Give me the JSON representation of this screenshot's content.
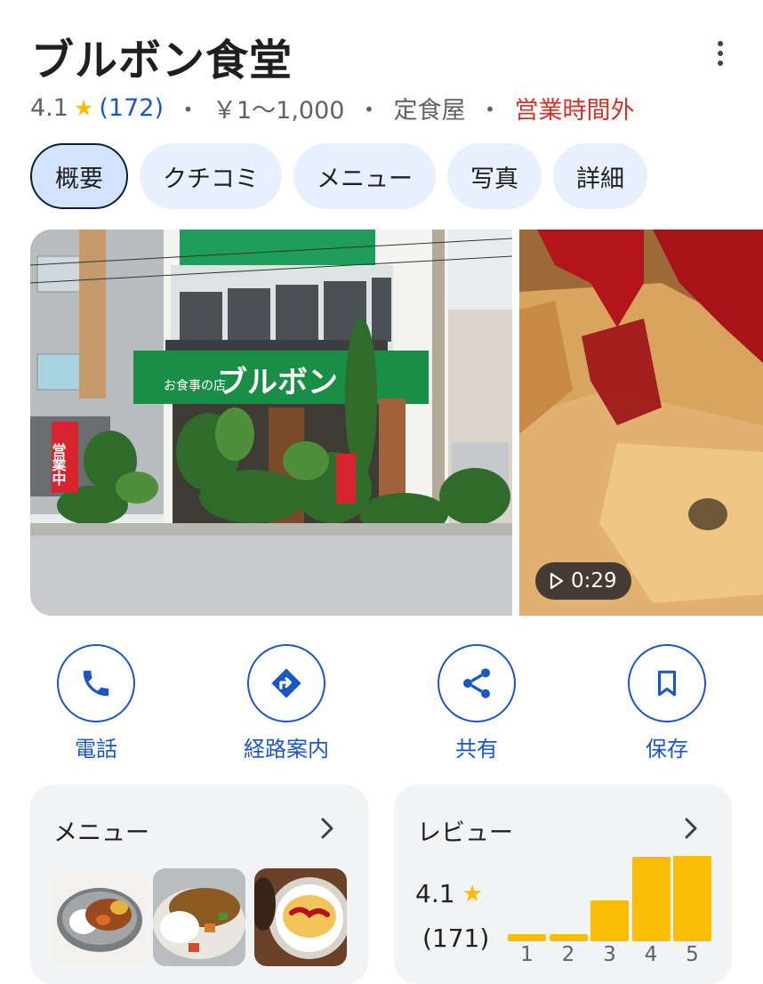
{
  "place": {
    "name": "ブルボン食堂",
    "rating": "4.1",
    "review_count": "(172)",
    "price": "￥1～1,000",
    "category": "定食屋",
    "status": "営業時間外",
    "separator": "・"
  },
  "tabs": [
    {
      "label": "概要",
      "active": true
    },
    {
      "label": "クチコミ",
      "active": false
    },
    {
      "label": "メニュー",
      "active": false
    },
    {
      "label": "写真",
      "active": false
    },
    {
      "label": "詳細",
      "active": false
    }
  ],
  "media": {
    "storefront_sign": "ブルボン",
    "storefront_sign_small": "お食事の店",
    "banner_text": "営業中",
    "video_duration": "0:29"
  },
  "actions": [
    {
      "label": "電話",
      "icon": "phone-icon"
    },
    {
      "label": "経路案内",
      "icon": "directions-icon"
    },
    {
      "label": "共有",
      "icon": "share-icon"
    },
    {
      "label": "保存",
      "icon": "bookmark-icon"
    }
  ],
  "menu_card": {
    "title": "メニュー"
  },
  "review_card": {
    "title": "レビュー",
    "rating": "4.1",
    "count": "(171)",
    "histogram": [
      {
        "stars": "1",
        "fraction": 0.08
      },
      {
        "stars": "2",
        "fraction": 0.08
      },
      {
        "stars": "3",
        "fraction": 0.48
      },
      {
        "stars": "4",
        "fraction": 0.99
      },
      {
        "stars": "5",
        "fraction": 1.0
      }
    ]
  },
  "colors": {
    "accent": "#1a56c5",
    "star": "#fbbc04",
    "closed": "#d93025",
    "tab_bg": "#e8f0fe",
    "tab_active_bg": "#d3e3fd"
  }
}
